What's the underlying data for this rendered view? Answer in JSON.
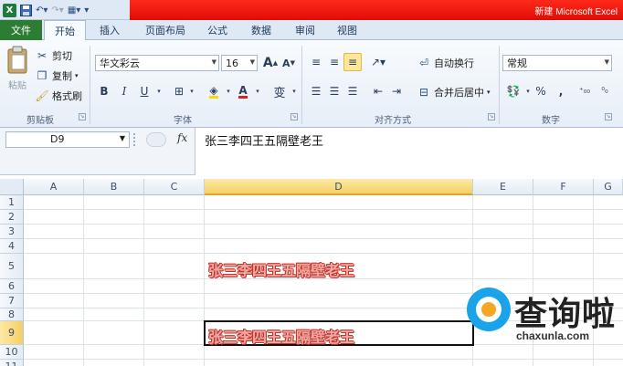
{
  "window": {
    "title": "新建 Microsoft Excel"
  },
  "qat": {
    "app_icon": "X",
    "save_icon": "floppy",
    "undo_icon": "undo",
    "redo_icon": "redo",
    "view_icon": "grid"
  },
  "tabs": [
    {
      "label": "文件"
    },
    {
      "label": "开始"
    },
    {
      "label": "插入"
    },
    {
      "label": "页面布局"
    },
    {
      "label": "公式"
    },
    {
      "label": "数据"
    },
    {
      "label": "审阅"
    },
    {
      "label": "视图"
    }
  ],
  "clipboard": {
    "paste": "粘贴",
    "cut": "剪切",
    "copy": "复制",
    "format_painter": "格式刷",
    "group": "剪贴板"
  },
  "font": {
    "name": "华文彩云",
    "size": "16",
    "grow": "A",
    "shrink": "A",
    "bold": "B",
    "italic": "I",
    "underline": "U",
    "color_letter": "A",
    "phonetic": "变",
    "group": "字体"
  },
  "alignment": {
    "wrap": "自动换行",
    "merge": "合并后居中",
    "group": "对齐方式"
  },
  "number": {
    "format": "常规",
    "percent": "%",
    "comma": ",",
    "group": "数字"
  },
  "formula_bar": {
    "name_box": "D9",
    "fx": "fx",
    "content": "张三李四王五隔壁老王"
  },
  "grid": {
    "columns": [
      "A",
      "B",
      "C",
      "D",
      "E",
      "F",
      "G"
    ],
    "rows": [
      "1",
      "2",
      "3",
      "4",
      "5",
      "6",
      "7",
      "8",
      "9",
      "10"
    ],
    "d5": "张三李四王五隔壁老王",
    "d9": "张三李四王五隔壁老王"
  },
  "watermark": {
    "title": "查询啦",
    "domain": "chaxunla.com"
  },
  "colors": {
    "file_tab": "#2d7c34",
    "title_red": "#e00c06",
    "selection_header": "#f5cf63",
    "art_text": "#f2a9a3",
    "watermark_blue": "#1aa3e8"
  }
}
